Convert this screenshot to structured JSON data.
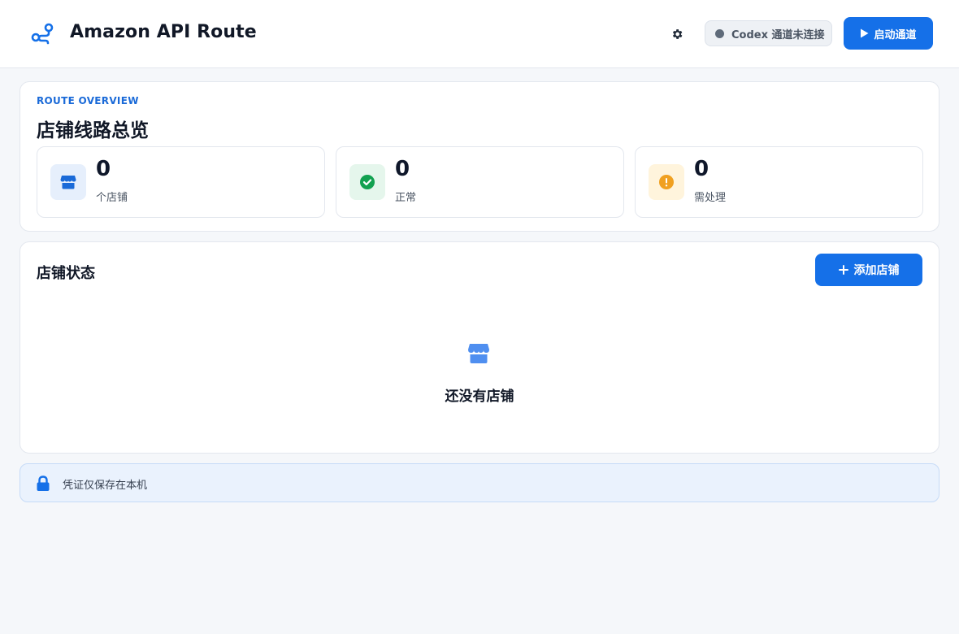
{
  "header": {
    "app_title": "Amazon API Route",
    "settings_icon": "gear-icon",
    "channel_status": "Codex 通道未连接",
    "start_button": "启动通道"
  },
  "overview": {
    "eyebrow": "ROUTE OVERVIEW",
    "title": "店铺线路总览",
    "stats": [
      {
        "value": "0",
        "label": "个店铺",
        "icon": "store-icon",
        "color": "#1a6ad8"
      },
      {
        "value": "0",
        "label": "正常",
        "icon": "check-circle-icon",
        "color": "#12a150"
      },
      {
        "value": "0",
        "label": "需处理",
        "icon": "warning-circle-icon",
        "color": "#f0a020"
      }
    ]
  },
  "stores": {
    "title": "店铺状态",
    "add_button": "添加店铺",
    "empty_text": "还没有店铺"
  },
  "notice": {
    "text": "凭证仅保存在本机",
    "icon": "lock-icon"
  },
  "colors": {
    "accent": "#1570e8",
    "success": "#12a150",
    "warning": "#f0a020",
    "background": "#f5f7fa"
  }
}
